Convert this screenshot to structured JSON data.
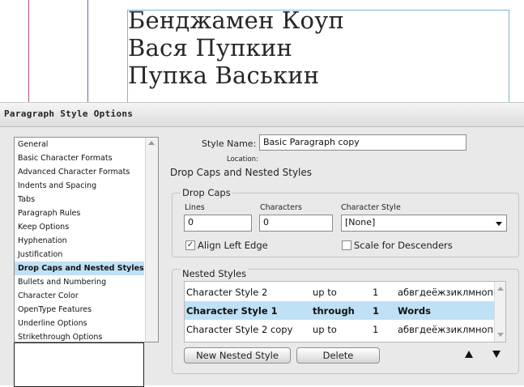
{
  "document": {
    "lines": [
      "Бенджамен Коуп",
      "Вася Пупкин",
      "Пупка Васькин"
    ]
  },
  "dialog": {
    "title": "Paragraph Style Options",
    "categories": [
      "General",
      "Basic Character Formats",
      "Advanced Character Formats",
      "Indents and Spacing",
      "Tabs",
      "Paragraph Rules",
      "Keep Options",
      "Hyphenation",
      "Justification",
      "Drop Caps and Nested Styles",
      "Bullets and Numbering",
      "Character Color",
      "OpenType Features",
      "Underline Options",
      "Strikethrough Options"
    ],
    "selected_category": "Drop Caps and Nested Styles",
    "style_name_label": "Style Name:",
    "style_name_value": "Basic Paragraph copy",
    "location_label": "Location:",
    "section_title": "Drop Caps and Nested Styles",
    "drop_caps": {
      "group_title": "Drop Caps",
      "lines_label": "Lines",
      "lines_value": "0",
      "characters_label": "Characters",
      "characters_value": "0",
      "character_style_label": "Character Style",
      "character_style_value": "[None]",
      "align_left_edge_label": "Align Left Edge",
      "align_left_edge_checked": true,
      "scale_descenders_label": "Scale for Descenders",
      "scale_descenders_checked": false
    },
    "nested_styles": {
      "group_title": "Nested Styles",
      "rows": [
        {
          "style": "Character Style 2",
          "rule": "up to",
          "count": "1",
          "target": "абвгдеёжзиклмноп..."
        },
        {
          "style": "Character Style 1",
          "rule": "through",
          "count": "1",
          "target": "Words"
        },
        {
          "style": "Character Style 2 copy",
          "rule": "up to",
          "count": "1",
          "target": "абвгдеёжзиклмноп..."
        }
      ],
      "selected_row": 1,
      "new_button": "New Nested Style",
      "delete_button": "Delete"
    }
  }
}
